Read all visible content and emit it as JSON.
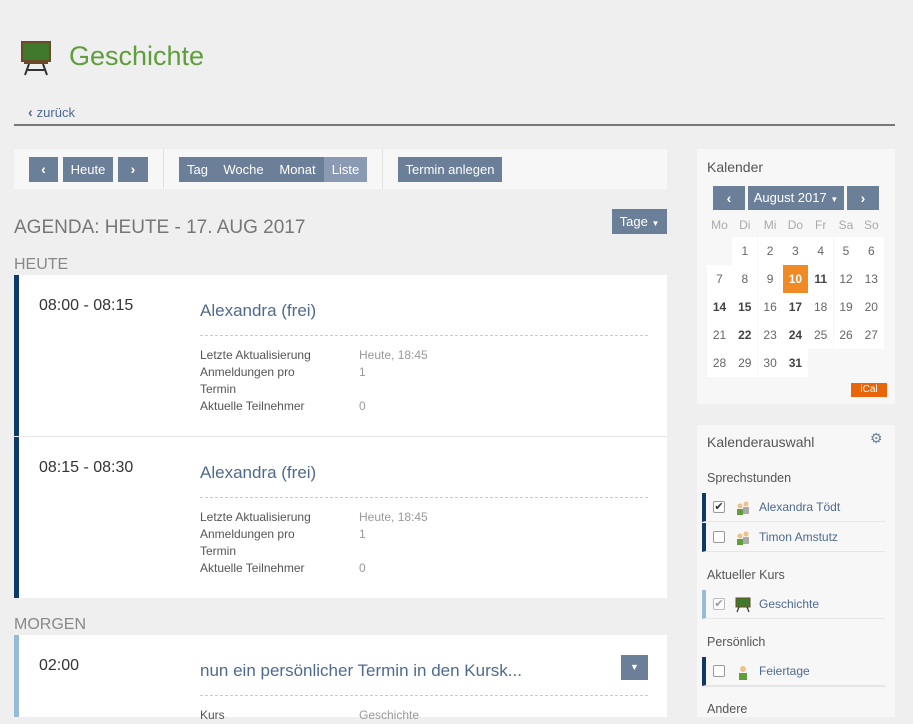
{
  "header": {
    "title": "Geschichte",
    "back_label": "zurück"
  },
  "toolbar": {
    "prev_label": "‹",
    "today_label": "Heute",
    "next_label": "›",
    "views": [
      "Tag",
      "Woche",
      "Monat",
      "Liste"
    ],
    "active_view": "Liste",
    "create_label": "Termin anlegen"
  },
  "agenda": {
    "title": "AGENDA: HEUTE - 17. AUG 2017",
    "range_button": "Tage",
    "days": [
      {
        "label": "HEUTE",
        "events": [
          {
            "time": "08:00 - 08:15",
            "title": "Alexandra (frei)",
            "rows": [
              {
                "label": "Letzte Aktualisierung",
                "value": "Heute, 18:45"
              },
              {
                "label": "Anmeldungen pro",
                "value": "1"
              },
              {
                "label": "Termin",
                "value": ""
              },
              {
                "label": "Aktuelle Teilnehmer",
                "value": "0"
              }
            ]
          },
          {
            "time": "08:15 - 08:30",
            "title": "Alexandra (frei)",
            "rows": [
              {
                "label": "Letzte Aktualisierung",
                "value": "Heute, 18:45"
              },
              {
                "label": "Anmeldungen pro",
                "value": "1"
              },
              {
                "label": "Termin",
                "value": ""
              },
              {
                "label": "Aktuelle Teilnehmer",
                "value": "0"
              }
            ]
          }
        ]
      },
      {
        "label": "MORGEN",
        "events": [
          {
            "time": "02:00",
            "title": "nun ein persönlicher Termin in den Kursk...",
            "rows": [
              {
                "label": "Kurs",
                "value": "Geschichte"
              }
            ]
          }
        ]
      }
    ]
  },
  "calendar": {
    "title": "Kalender",
    "month_label": "August 2017",
    "weekdays": [
      "Mo",
      "Di",
      "Mi",
      "Do",
      "Fr",
      "Sa",
      "So"
    ],
    "weeks": [
      [
        "",
        "1",
        "2",
        "3",
        "4",
        "5",
        "6"
      ],
      [
        "7",
        "8",
        "9",
        "10",
        "11",
        "12",
        "13"
      ],
      [
        "14",
        "15",
        "16",
        "17",
        "18",
        "19",
        "20"
      ],
      [
        "21",
        "22",
        "23",
        "24",
        "25",
        "26",
        "27"
      ],
      [
        "28",
        "29",
        "30",
        "31",
        "",
        "",
        ""
      ]
    ],
    "highlight_day": "10",
    "bold_days": [
      "11",
      "14",
      "15",
      "17",
      "22",
      "24",
      "31"
    ],
    "ical_label": "iCal"
  },
  "calendar_selection": {
    "title": "Kalenderauswahl",
    "groups": [
      {
        "label": "Sprechstunden",
        "items": [
          {
            "name": "Alexandra Tödt",
            "checked": true
          },
          {
            "name": "Timon Amstutz",
            "checked": false
          }
        ]
      },
      {
        "label": "Aktueller Kurs",
        "items": [
          {
            "name": "Geschichte",
            "checked": true
          }
        ]
      },
      {
        "label": "Persönlich",
        "items": [
          {
            "name": "Feiertage",
            "checked": false
          }
        ]
      },
      {
        "label": "Andere",
        "items": []
      }
    ]
  },
  "colors": {
    "accent": "#6b7f99",
    "title_green": "#5f9e3a",
    "event_border": "#0e3a6b",
    "event_border_light": "#96bbd6",
    "today_orange": "#f08a24",
    "ical_orange": "#e8650a"
  }
}
